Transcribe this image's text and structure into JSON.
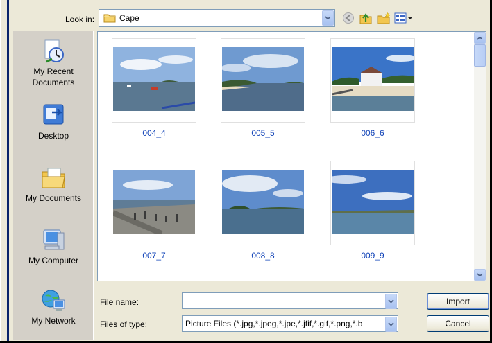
{
  "toolbar": {
    "look_in_label": "Look in:",
    "look_in_value": "Cape",
    "icons": [
      "back-icon",
      "up-folder-icon",
      "new-folder-icon",
      "view-menu-icon"
    ]
  },
  "places": [
    {
      "label": "My Recent Documents",
      "icon": "recent-documents-icon"
    },
    {
      "label": "Desktop",
      "icon": "desktop-icon"
    },
    {
      "label": "My Documents",
      "icon": "my-documents-icon"
    },
    {
      "label": "My Computer",
      "icon": "my-computer-icon"
    },
    {
      "label": "My Network",
      "icon": "my-network-icon"
    }
  ],
  "files": [
    {
      "name": "004_4"
    },
    {
      "name": "005_5"
    },
    {
      "name": "006_6"
    },
    {
      "name": "007_7"
    },
    {
      "name": "008_8"
    },
    {
      "name": "009_9"
    }
  ],
  "form": {
    "file_name_label": "File name:",
    "file_name_value": "",
    "file_type_label": "Files of type:",
    "file_type_value": "Picture Files (*.jpg,*.jpeg,*.jpe,*.jfif,*.gif,*.png,*.b"
  },
  "buttons": {
    "import_label": "Import",
    "cancel_label": "Cancel"
  },
  "colors": {
    "accent_blue": "#0a246a",
    "link_blue": "#1244b8",
    "dialog_bg": "#ece9d8"
  }
}
